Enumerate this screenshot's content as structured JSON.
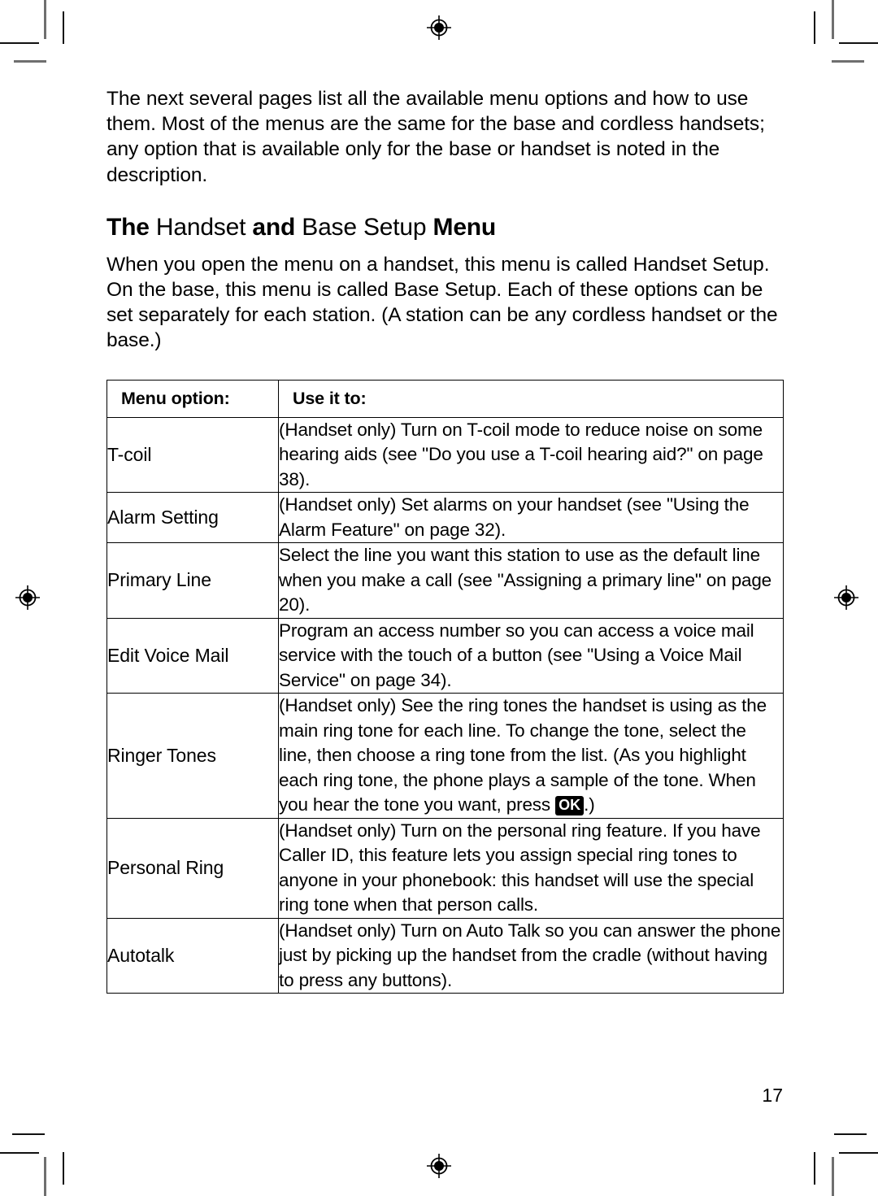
{
  "document": {
    "page_number": "17",
    "intro_paragraph": "The next several pages list all the available menu options and how to use them. Most of the menus are the same for the base and cordless handsets; any option that is available only for the base or handset is noted in the description.",
    "heading": {
      "part1_bold": "The",
      "part2": "Handset",
      "part3_bold": "and",
      "part4": "Base Setup",
      "part5_bold": "Menu"
    },
    "section_paragraph": "When you open the menu on a handset, this menu is called Handset Setup. On the base, this menu is called Base Setup. Each of these options can be set separately for each station. (A station can be any cordless handset or the base.)"
  },
  "table": {
    "headers": {
      "option": "Menu option:",
      "use": "Use it to:"
    },
    "rows": [
      {
        "option": "T-coil",
        "description": "(Handset only) Turn on T-coil mode to reduce noise on some hearing aids (see \"Do you use a T-coil hearing aid?\" on page 38)."
      },
      {
        "option": "Alarm Setting",
        "description": "(Handset only) Set alarms on your handset (see \"Using the Alarm Feature\" on page 32)."
      },
      {
        "option": "Primary Line",
        "description": "Select the line you want this station to use as the default line when you make a call (see \"Assigning a primary line\" on page 20)."
      },
      {
        "option": "Edit Voice Mail",
        "description": "Program an access number so you can access a voice mail service with the touch of a button (see \"Using a Voice Mail Service\" on page 34)."
      },
      {
        "option": "Ringer Tones",
        "description_before_key": "(Handset only) See the ring tones the handset is using as the main ring tone for each line. To change the tone, select the line, then choose a ring tone from the list. (As you highlight each ring tone, the phone plays a sample of the tone. When you hear the tone you want, press ",
        "key_label": "OK",
        "description_after_key": ".)"
      },
      {
        "option": "Personal Ring",
        "description": "(Handset only) Turn on the personal ring feature. If you have Caller ID, this feature lets you assign special ring tones to anyone in your phonebook: this handset will use the special ring tone when that person calls."
      },
      {
        "option": "Autotalk",
        "description": "(Handset only) Turn on Auto Talk so you can answer the phone just by picking up the handset from the cradle (without having to press any buttons)."
      }
    ]
  },
  "printer_marks": {
    "registration_icon": "registration-target-icon",
    "crop_mark": "crop-mark"
  }
}
